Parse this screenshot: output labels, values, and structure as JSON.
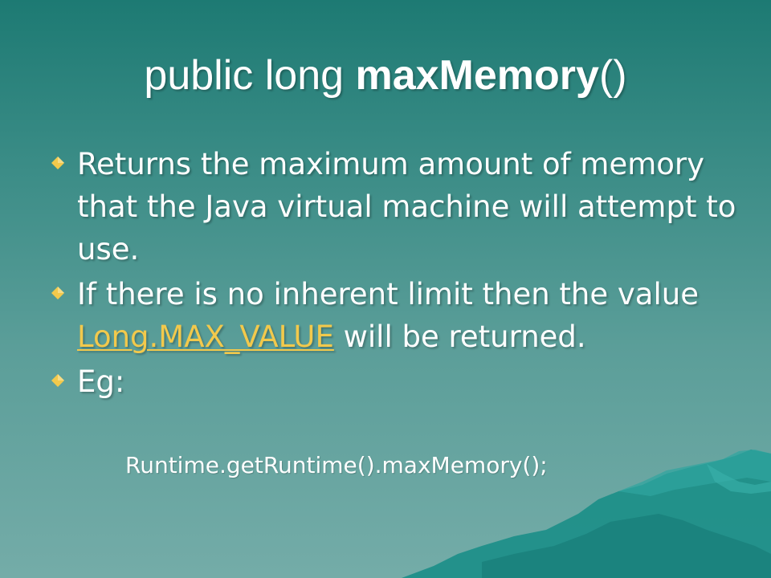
{
  "slide": {
    "title_prefix": "public long ",
    "title_method": "maxMemory",
    "title_suffix": "()",
    "bullets": [
      {
        "text": "Returns the maximum amount of memory that the Java virtual machine will attempt to use."
      },
      {
        "text_before": "If there is no inherent limit then the value ",
        "link": "Long.MAX_VALUE",
        "text_after": " will be returned."
      },
      {
        "text": "Eg:"
      }
    ],
    "code_example": "Runtime.getRuntime().maxMemory();"
  },
  "colors": {
    "background_top": "#1d7a73",
    "background_bottom": "#74aca8",
    "bullet_diamond": "#f2c94c",
    "link": "#f2c94c",
    "mountain": "#1f8f89"
  },
  "icons": {
    "bullet": "diamond-bullet-icon"
  }
}
